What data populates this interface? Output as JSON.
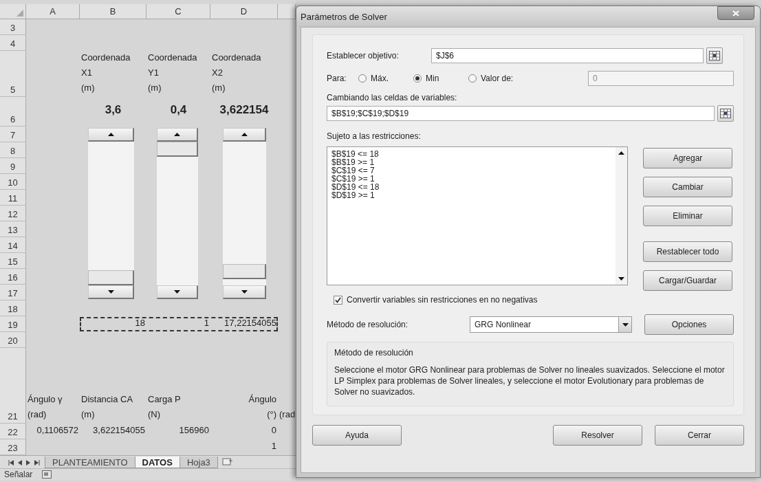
{
  "sheet": {
    "columns": [
      "A",
      "B",
      "C",
      "D"
    ],
    "rows": [
      {
        "number": "3",
        "kind": "plain"
      },
      {
        "number": "4",
        "kind": "plain"
      },
      {
        "number": "5",
        "kind": "caption",
        "cells": {
          "B": {
            "kind": "text",
            "lines": [
              "Coordenada",
              "X1",
              "(m)"
            ]
          },
          "C": {
            "kind": "text",
            "lines": [
              "Coordenada",
              "Y1",
              "(m)"
            ]
          },
          "D": {
            "kind": "text",
            "lines": [
              "Coordenada",
              "X2",
              "(m)"
            ]
          }
        }
      },
      {
        "number": "6",
        "kind": "bold",
        "cells": {
          "B": {
            "kind": "title",
            "lines": [
              "3,6"
            ]
          },
          "C": {
            "kind": "title",
            "lines": [
              "0,4"
            ]
          },
          "D": {
            "kind": "title",
            "lines": [
              "3,622154"
            ]
          }
        }
      },
      {
        "number": "7",
        "kind": "slider"
      },
      {
        "number": "8",
        "kind": "slider"
      },
      {
        "number": "9",
        "kind": "slider"
      },
      {
        "number": "10",
        "kind": "slider"
      },
      {
        "number": "11",
        "kind": "slider"
      },
      {
        "number": "12",
        "kind": "slider"
      },
      {
        "number": "13",
        "kind": "slider"
      },
      {
        "number": "14",
        "kind": "slider"
      },
      {
        "number": "15",
        "kind": "slider"
      },
      {
        "number": "16",
        "kind": "slider"
      },
      {
        "number": "17",
        "kind": "slider"
      },
      {
        "number": "18",
        "kind": "plain"
      },
      {
        "number": "19",
        "kind": "plain",
        "marquee": true,
        "cells": {
          "B": {
            "kind": "number",
            "lines": [
              "18"
            ]
          },
          "C": {
            "kind": "number",
            "lines": [
              "1"
            ]
          },
          "D": {
            "kind": "number",
            "lines": [
              "17,22154055"
            ]
          }
        }
      },
      {
        "number": "20",
        "kind": "plain"
      },
      {
        "number": "21",
        "kind": "tall_caption",
        "cells": {
          "A": {
            "kind": "text",
            "lines": [
              "Ángulo γ",
              "(rad)"
            ]
          },
          "B": {
            "kind": "text",
            "lines": [
              "Distancia CA",
              "(m)"
            ]
          },
          "C": {
            "kind": "text",
            "lines": [
              "Carga P",
              "(N)"
            ]
          },
          "D": {
            "kind": "right_text",
            "lines": [
              "Ángulo",
              "(°)"
            ]
          },
          "E": {
            "lines": [
              "(rad"
            ]
          }
        }
      },
      {
        "number": "22",
        "kind": "plain",
        "cells": {
          "A": {
            "kind": "number",
            "lines": [
              "0,1106572"
            ]
          },
          "B": {
            "kind": "number",
            "lines": [
              "3,622154055"
            ]
          },
          "C": {
            "kind": "number",
            "lines": [
              "156960"
            ]
          },
          "D": {
            "kind": "number",
            "lines": [
              "0"
            ]
          }
        }
      },
      {
        "number": "23",
        "kind": "plain",
        "cells": {
          "D": {
            "kind": "number",
            "lines": [
              "1"
            ]
          }
        }
      }
    ],
    "sliders": [
      {
        "kind": "scrollbar"
      },
      {
        "kind": "scrollbar"
      },
      {
        "kind": "scrollbar"
      }
    ],
    "sheet_tabs": [
      {
        "label": "PLANTEAMIENTO",
        "selected": false
      },
      {
        "label": "DATOS",
        "selected": true
      },
      {
        "label": "Hoja3",
        "selected": false
      }
    ],
    "status_bar": {
      "mode": "Señalar"
    }
  },
  "dialog": {
    "title": "Parámetros de Solver",
    "objective": {
      "label": "Establecer objetivo:",
      "value": "$J$6"
    },
    "to": {
      "label": "Para:",
      "options": [
        {
          "label": "Máx.",
          "selected": false
        },
        {
          "label": "Min",
          "selected": true
        },
        {
          "label": "Valor de:",
          "selected": false
        }
      ],
      "value_field": {
        "value": "0",
        "disabled": true
      }
    },
    "variables": {
      "label": "Cambiando las celdas de variables:",
      "value": "$B$19;$C$19;$D$19"
    },
    "constraints": {
      "label": "Sujeto a las restricciones:",
      "items": [
        "$B$19 <= 18",
        "$B$19 >= 1",
        "$C$19 <= 7",
        "$C$19 >= 1",
        "$D$19 <= 18",
        "$D$19 >= 1"
      ]
    },
    "side_buttons": [
      "Agregar",
      "Cambiar",
      "Eliminar",
      "Restablecer todo",
      "Cargar/Guardar"
    ],
    "nonnegative": {
      "label": "Convertir variables sin restricciones en no negativas",
      "checked": true
    },
    "method": {
      "label": "Método de resolución:",
      "value": "GRG Nonlinear",
      "options_button": "Opciones"
    },
    "method_group": {
      "title": "Método de resolución",
      "description": "Seleccione el motor GRG Nonlinear para problemas de Solver no lineales suavizados. Seleccione el motor LP Simplex para problemas de Solver lineales, y seleccione el motor Evolutionary para problemas de Solver no suavizados."
    },
    "footer_buttons": [
      "Ayuda",
      "Resolver",
      "Cerrar"
    ]
  }
}
